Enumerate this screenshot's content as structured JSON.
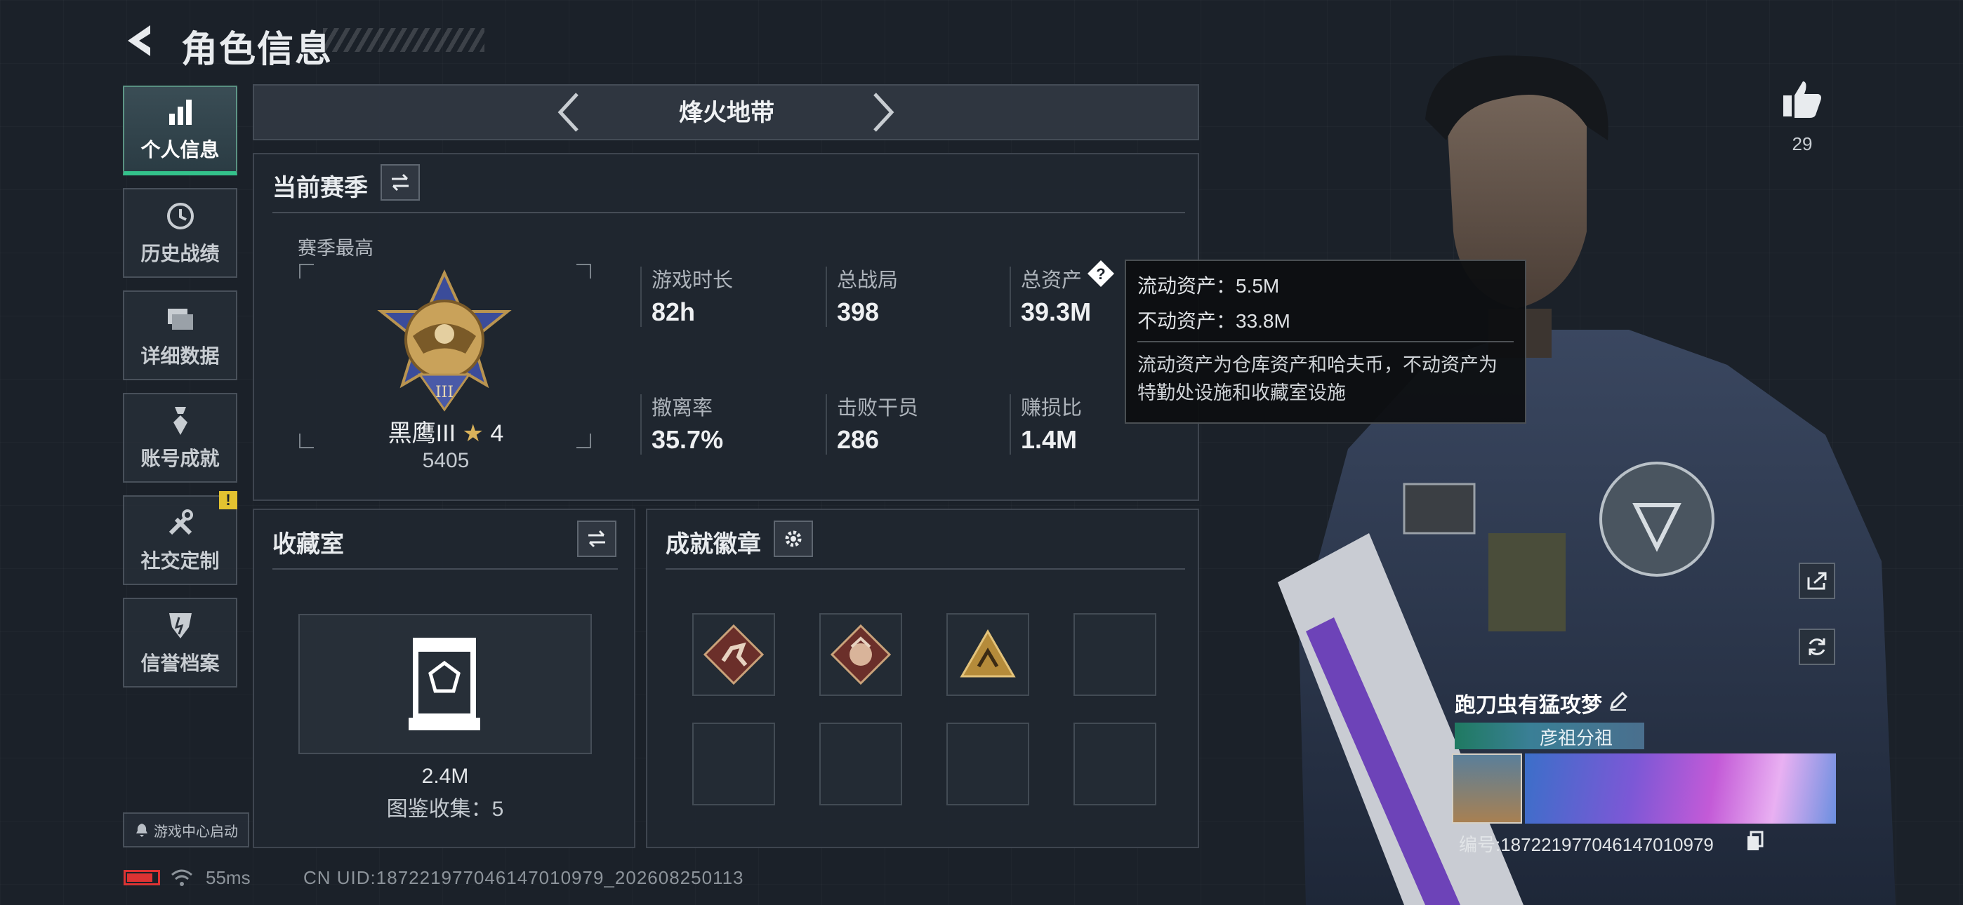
{
  "header": {
    "title": "角色信息"
  },
  "nav": {
    "items": [
      {
        "label": "个人信息",
        "icon": "bar-chart-icon",
        "active": true
      },
      {
        "label": "历史战绩",
        "icon": "history-icon"
      },
      {
        "label": "详细数据",
        "icon": "folder-icon"
      },
      {
        "label": "账号成就",
        "icon": "medal-icon"
      },
      {
        "label": "社交定制",
        "icon": "tools-icon",
        "badge": "!"
      },
      {
        "label": "信誉档案",
        "icon": "shield-icon"
      }
    ],
    "game_center": "游戏中心启动"
  },
  "mode": {
    "title": "烽火地带"
  },
  "season": {
    "title": "当前赛季",
    "best_label": "赛季最高",
    "rank_name": "黑鹰III",
    "rank_stars": "4",
    "rank_score": "5405",
    "stats": [
      {
        "label": "游戏时长",
        "value": "82h"
      },
      {
        "label": "总战局",
        "value": "398"
      },
      {
        "label": "总资产",
        "value": "39.3M"
      },
      {
        "label": "撤离率",
        "value": "35.7%"
      },
      {
        "label": "击败干员",
        "value": "286"
      },
      {
        "label": "赚损比",
        "value": "1.4M"
      }
    ]
  },
  "tooltip": {
    "liquid": "流动资产：5.5M",
    "fixed": "不动资产：33.8M",
    "desc": "流动资产为仓库资产和哈夫币，不动资产为特勤处设施和收藏室设施"
  },
  "collection": {
    "title": "收藏室",
    "value": "2.4M",
    "count": "图鉴收集：5"
  },
  "badges": {
    "title": "成就徽章"
  },
  "status": {
    "ping": "55ms",
    "uid": "CN UID:187221977046147010979_202608250113",
    "battery_color": "#dd3333"
  },
  "player": {
    "likes": "29",
    "name": "跑刀虫有猛攻梦",
    "tag": "彦祖分祖",
    "id": "编号:187221977046147010979"
  },
  "colors": {
    "accent": "#33c28b",
    "warning": "#e3c230"
  }
}
